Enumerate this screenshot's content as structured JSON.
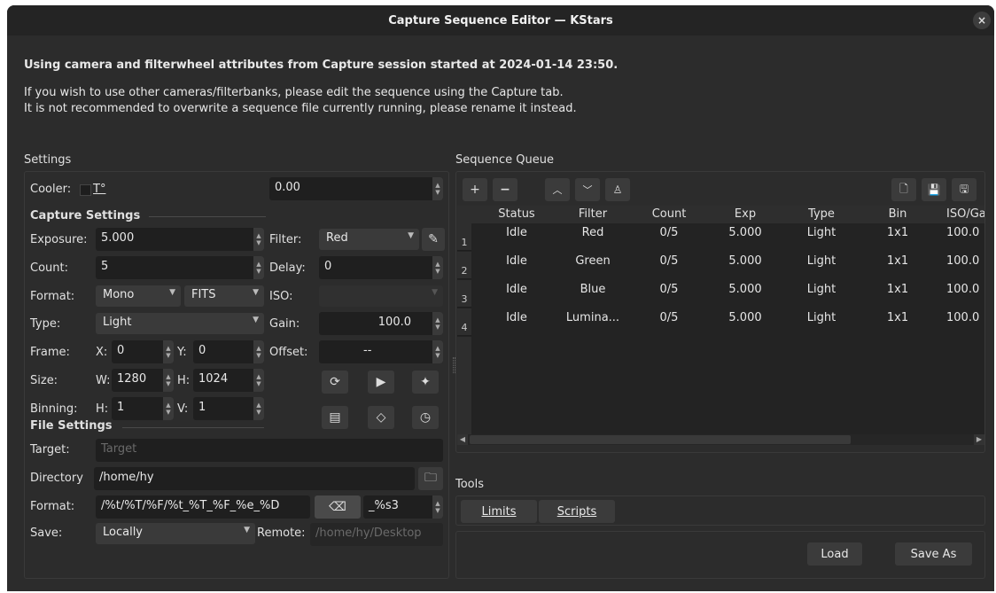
{
  "window": {
    "title": "Capture Sequence Editor — KStars",
    "close": "×"
  },
  "messages": {
    "line1": "Using camera and filterwheel attributes from Capture session started at 2024-01-14 23:50.",
    "line2": "If you wish to use other cameras/filterbanks, please edit the sequence using the Capture tab.",
    "line3": "It is not recommended to overwrite a sequence file currently running, please rename it instead."
  },
  "settings": {
    "title": "Settings",
    "cooler_label": "Cooler:",
    "temp_label": "T°",
    "temp_value": "0.00",
    "capture_heading": "Capture Settings",
    "exposure_label": "Exposure:",
    "exposure_value": "5.000",
    "filter_label": "Filter:",
    "filter_value": "Red",
    "count_label": "Count:",
    "count_value": "5",
    "delay_label": "Delay:",
    "delay_value": "0",
    "format_label": "Format:",
    "format_mono": "Mono",
    "format_fits": "FITS",
    "iso_label": "ISO:",
    "type_label": "Type:",
    "type_value": "Light",
    "gain_label": "Gain:",
    "gain_value": "100.0",
    "frame_label": "Frame:",
    "x_label": "X:",
    "x_value": "0",
    "y_label": "Y:",
    "y_value": "0",
    "offset_label": "Offset:",
    "offset_value": "--",
    "size_label": "Size:",
    "w_label": "W:",
    "w_value": "1280",
    "h_label": "H:",
    "h_value": "1024",
    "binning_label": "Binning:",
    "bin_h_label": "H:",
    "bin_h_value": "1",
    "bin_v_label": "V:",
    "bin_v_value": "1",
    "file_heading": "File Settings",
    "target_label": "Target:",
    "target_placeholder": "Target",
    "directory_label": "Directory",
    "directory_value": "/home/hy",
    "fformat_label": "Format:",
    "fformat_value": "/%t/%T/%F/%t_%T_%F_%e_%D",
    "suffix_value": "_%s3",
    "save_label": "Save:",
    "save_value": "Locally",
    "remote_label": "Remote:",
    "remote_placeholder": "/home/hy/Desktop"
  },
  "queue": {
    "title": "Sequence Queue",
    "columns": [
      "Status",
      "Filter",
      "Count",
      "Exp",
      "Type",
      "Bin",
      "ISO/Ga"
    ],
    "rows": [
      {
        "num": "1",
        "status": "Idle",
        "filter": "Red",
        "count": "0/5",
        "exp": "5.000",
        "type": "Light",
        "bin": "1x1",
        "iso": "100.0"
      },
      {
        "num": "2",
        "status": "Idle",
        "filter": "Green",
        "count": "0/5",
        "exp": "5.000",
        "type": "Light",
        "bin": "1x1",
        "iso": "100.0"
      },
      {
        "num": "3",
        "status": "Idle",
        "filter": "Blue",
        "count": "0/5",
        "exp": "5.000",
        "type": "Light",
        "bin": "1x1",
        "iso": "100.0"
      },
      {
        "num": "4",
        "status": "Idle",
        "filter": "Lumina...",
        "count": "0/5",
        "exp": "5.000",
        "type": "Light",
        "bin": "1x1",
        "iso": "100.0"
      }
    ]
  },
  "tools": {
    "title": "Tools",
    "limits": "Limits",
    "scripts": "Scripts"
  },
  "footer": {
    "load": "Load",
    "save_as": "Save As"
  }
}
